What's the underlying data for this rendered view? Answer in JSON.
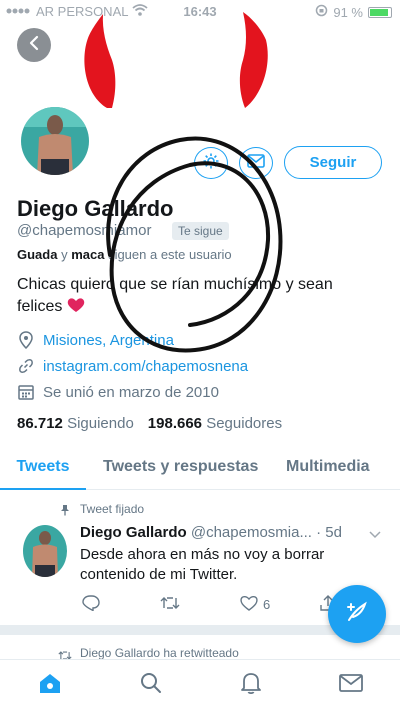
{
  "status_bar": {
    "carrier": "AR PERSONAL",
    "time": "16:43",
    "battery": "91 %",
    "battery_level": 0.91
  },
  "profile": {
    "name": "Diego Gallardo",
    "handle": "@chapemosmiamor",
    "follows_you_badge": "Te sigue",
    "followed_by_names_1": "Guada",
    "followed_by_join": " y ",
    "followed_by_names_2": "maca",
    "followed_by_suffix": " siguen a este usuario",
    "bio": "Chicas quiero que se rían muchísimo y sean felices",
    "bio_emoji": "❤️",
    "location": "Misiones, Argentina",
    "website": "instagram.com/chapemosnena",
    "joined": "Se unió en marzo de 2010",
    "following_count": "86.712",
    "following_label": "Siguiendo",
    "followers_count": "198.666",
    "followers_label": "Seguidores",
    "follow_button": "Seguir"
  },
  "tabs": [
    {
      "label": "Tweets",
      "active": true
    },
    {
      "label": "Tweets y respuestas",
      "active": false
    },
    {
      "label": "Multimedia",
      "active": false
    }
  ],
  "pinned_tweet": {
    "pinned_label": "Tweet fijado",
    "author_name": "Diego Gallardo",
    "author_handle": "@chapemosmia...",
    "time": "· 5d",
    "text": "Desde ahora en más no voy a borrar contenido de mi Twitter.",
    "likes": "6"
  },
  "retweet_label": "Diego Gallardo ha retwitteado",
  "colors": {
    "accent": "#1da1f2",
    "text": "#14171a",
    "muted": "#657786",
    "scribble_red": "#e3141e",
    "heart": "#e0245e"
  },
  "icons": {
    "back": "back-arrow-icon",
    "gear": "gear-icon",
    "mail": "mail-icon",
    "location": "location-pin-icon",
    "link": "link-icon",
    "calendar": "calendar-icon",
    "pin": "pin-icon",
    "reply": "reply-icon",
    "retweet": "retweet-icon",
    "like": "heart-icon",
    "share": "share-icon",
    "compose": "compose-icon",
    "home": "home-icon",
    "search": "search-icon",
    "notifications": "bell-icon",
    "messages": "envelope-icon"
  }
}
